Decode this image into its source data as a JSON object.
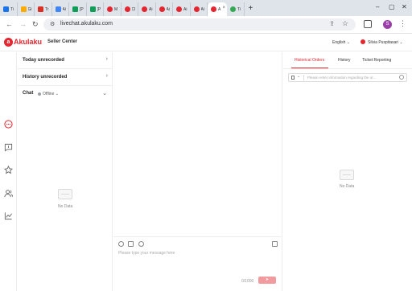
{
  "browser": {
    "tabs": [
      {
        "title": "Ti",
        "color": "#1a73e8",
        "round": false
      },
      {
        "title": "Gi",
        "color": "#f9ab00",
        "round": false
      },
      {
        "title": "Tr",
        "color": "#d93025",
        "round": false
      },
      {
        "title": "Ai",
        "color": "#4285f4",
        "round": false
      },
      {
        "title": "[P",
        "color": "#0f9d58",
        "round": false
      },
      {
        "title": "[P",
        "color": "#0f9d58",
        "round": false
      },
      {
        "title": "M",
        "color": "#e3262f",
        "round": true
      },
      {
        "title": "Cl",
        "color": "#e3262f",
        "round": true
      },
      {
        "title": "Ai",
        "color": "#e3262f",
        "round": true
      },
      {
        "title": "Ai",
        "color": "#e3262f",
        "round": true
      },
      {
        "title": "Ai",
        "color": "#e3262f",
        "round": true
      },
      {
        "title": "Ai",
        "color": "#e3262f",
        "round": true
      },
      {
        "title": "A",
        "color": "#e3262f",
        "round": true,
        "active": true
      },
      {
        "title": "Ti",
        "color": "#34a853",
        "round": true
      }
    ],
    "new_tab": "+",
    "url": "livechat.akulaku.com",
    "profile_initial": "S"
  },
  "header": {
    "logo_text": "Akulaku",
    "section": "Seller Center",
    "language": "English ⌄",
    "user_name": "Silvia Puspitasari ⌄"
  },
  "rail": {
    "icons": [
      "chat-bubble-icon",
      "message-square-icon",
      "star-icon",
      "users-icon",
      "chart-icon"
    ],
    "accent": "#e3262f"
  },
  "sessions": {
    "today_unrecorded": "Today unrecorded",
    "history_unrecorded": "History unrecorded",
    "chat_label": "Chat",
    "status": "Offline ⌄",
    "no_data": "No Data"
  },
  "composer": {
    "placeholder": "Please type your message here",
    "counter": "0/1000",
    "send": "➤"
  },
  "right_panel": {
    "tabs": [
      "Historical Orders",
      "History",
      "Ticket Reporting"
    ],
    "active_tab": "Historical Orders",
    "search_placeholder": "Please enter information regarding the or...",
    "no_data": "No Data"
  }
}
